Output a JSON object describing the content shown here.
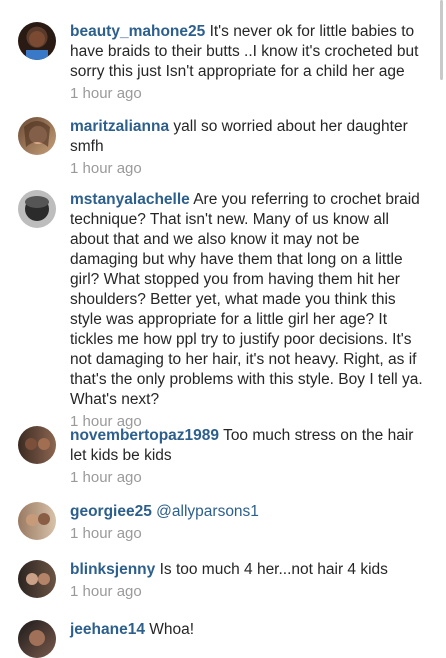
{
  "comments": [
    {
      "username": "beauty_mahone25",
      "text": "It's never ok for little babies to have braids to their butts ..I know it's crocheted but sorry this just Isn't appropriate for a child her age",
      "time": "1 hour ago"
    },
    {
      "username": "maritzalianna",
      "text": "yall so worried about her daughter smfh",
      "time": "1 hour ago"
    },
    {
      "username": "mstanyalachelle",
      "text": "Are you referring to crochet braid technique? That isn't new. Many of us know all about that and we also know it may not be damaging but why have them that long on a little girl? What stopped you from having them hit her shoulders? Better yet, what made you think this style was appropriate for a little girl her age? It tickles me how ppl try to justify poor decisions. It's not damaging to her hair, it's not heavy. Right, as if that's the only problems with this style. Boy I tell ya. What's next?",
      "time": "1 hour ago"
    },
    {
      "username": "novembertopaz1989",
      "text": "Too much stress on the hair let kids be kids",
      "time": "1 hour ago"
    },
    {
      "username": "georgiee25",
      "text": "@allyparsons1",
      "time": "1 hour ago"
    },
    {
      "username": "blinksjenny",
      "text": "Is too much 4 her...not hair 4 kids",
      "time": "1 hour ago"
    },
    {
      "username": "jeehane14",
      "text": "Whoa!",
      "time": ""
    }
  ]
}
